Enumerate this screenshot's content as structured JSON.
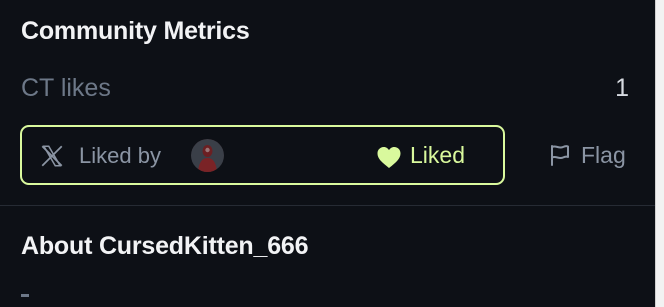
{
  "community_metrics": {
    "title": "Community Metrics",
    "ct_likes_label": "CT likes",
    "ct_likes_value": "1",
    "liked_by_label": "Liked by",
    "liked_label": "Liked",
    "flag_label": "Flag",
    "accent_color": "#d9f99d",
    "icons": [
      "x-logo-icon",
      "heart-icon",
      "flag-icon"
    ]
  },
  "about": {
    "title": "About CursedKitten_666"
  }
}
